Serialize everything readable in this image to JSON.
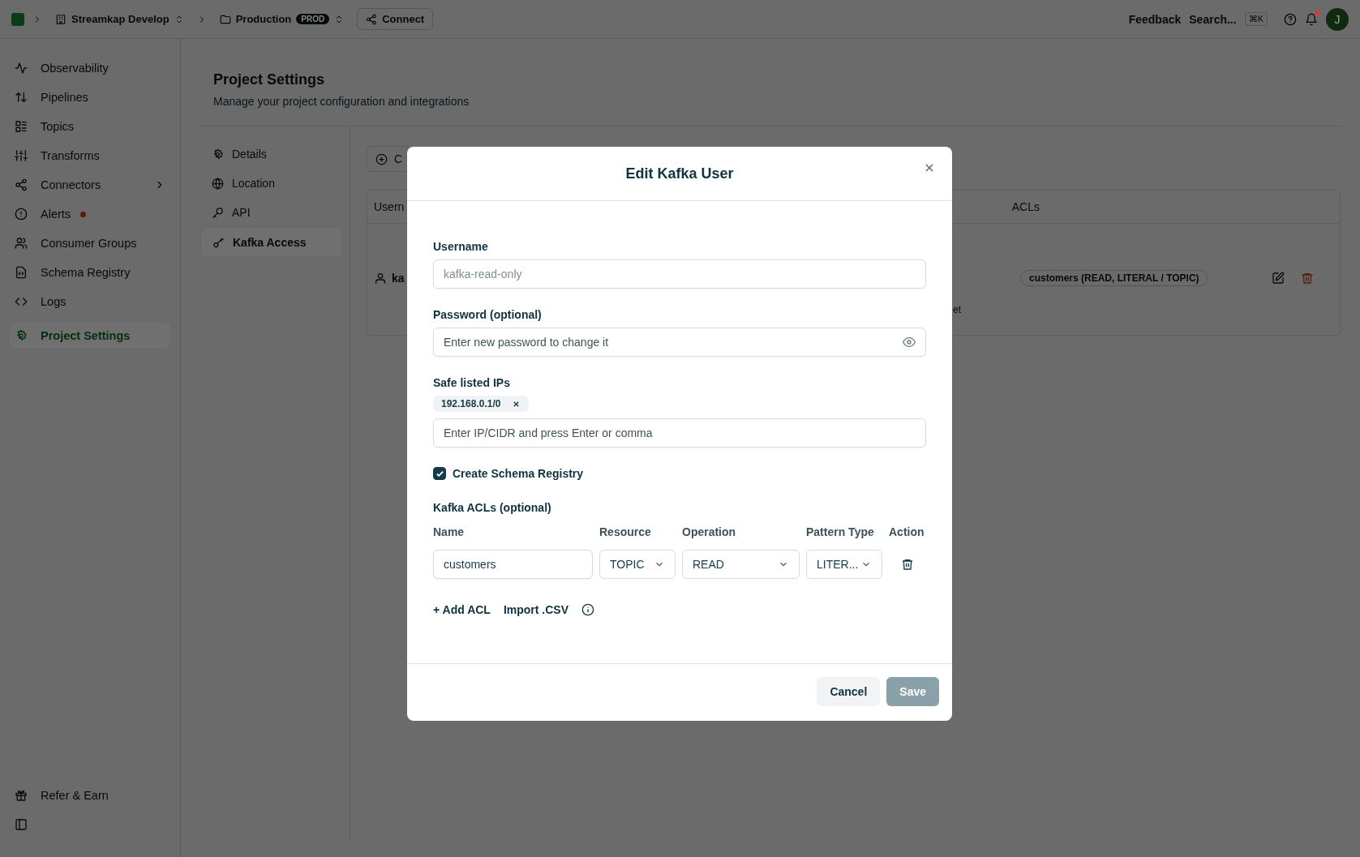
{
  "topbar": {
    "org": "Streamkap Develop",
    "env": "Production",
    "env_badge": "PROD",
    "connect": "Connect",
    "feedback": "Feedback",
    "search": "Search...",
    "shortcut": "⌘K",
    "avatar": "J",
    "notification": true
  },
  "sidebar": {
    "items": [
      {
        "label": "Observability",
        "selected": false,
        "dot": false,
        "chevron": false
      },
      {
        "label": "Pipelines",
        "selected": false,
        "dot": false,
        "chevron": false
      },
      {
        "label": "Topics",
        "selected": false,
        "dot": false,
        "chevron": false
      },
      {
        "label": "Transforms",
        "selected": false,
        "dot": false,
        "chevron": false
      },
      {
        "label": "Connectors",
        "selected": false,
        "dot": false,
        "chevron": true
      },
      {
        "label": "Alerts",
        "selected": false,
        "dot": true,
        "chevron": false
      },
      {
        "label": "Consumer Groups",
        "selected": false,
        "dot": false,
        "chevron": false
      },
      {
        "label": "Schema Registry",
        "selected": false,
        "dot": false,
        "chevron": false
      },
      {
        "label": "Logs",
        "selected": false,
        "dot": false,
        "chevron": false
      },
      {
        "label": "Project Settings",
        "selected": true,
        "dot": false,
        "chevron": false
      }
    ],
    "footer": [
      {
        "label": "Refer & Earn"
      }
    ]
  },
  "page": {
    "title": "Project Settings",
    "subtitle": "Manage your project configuration and integrations",
    "nav": [
      {
        "label": "Details",
        "selected": false
      },
      {
        "label": "Location",
        "selected": false
      },
      {
        "label": "API",
        "selected": false
      },
      {
        "label": "Kafka Access",
        "selected": true
      }
    ],
    "create_button": "C",
    "table": {
      "columns": [
        "Usern",
        "ACLs"
      ],
      "rows": [
        {
          "username": "ka",
          "acl": "customers (READ, LITERAL / TOPIC)",
          "note": "et"
        }
      ]
    }
  },
  "modal": {
    "title": "Edit Kafka User",
    "username": {
      "label": "Username",
      "value": "kafka-read-only",
      "disabled": true
    },
    "password": {
      "label": "Password (optional)",
      "placeholder": "Enter new password to change it"
    },
    "ips": {
      "label": "Safe listed IPs",
      "tags": [
        "192.168.0.1/0"
      ],
      "placeholder": "Enter IP/CIDR and press Enter or comma"
    },
    "schema_registry": {
      "label": "Create Schema Registry",
      "checked": true
    },
    "acls": {
      "title": "Kafka ACLs (optional)",
      "columns": [
        "Name",
        "Resource",
        "Operation",
        "Pattern Type",
        "Action"
      ],
      "rows": [
        {
          "name": "customers",
          "resource": "TOPIC",
          "operation": "READ",
          "pattern": "LITER..."
        }
      ],
      "add": "+ Add ACL",
      "import": "Import .CSV"
    },
    "buttons": [
      {
        "label": "Cancel",
        "kind": "secondary",
        "disabled": false
      },
      {
        "label": "Save",
        "kind": "primary",
        "disabled": true
      }
    ]
  }
}
